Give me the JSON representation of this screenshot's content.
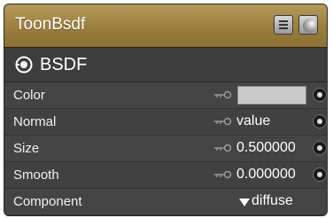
{
  "node": {
    "title": "ToonBsdf",
    "menu_icon": "menu-icon",
    "preview_icon": "sphere-preview-icon",
    "output": {
      "label": "BSDF",
      "icon": "output-socket-icon"
    }
  },
  "inputs": [
    {
      "label": "Color",
      "kind": "color",
      "swatch_color": "#c9c9c9"
    },
    {
      "label": "Normal",
      "kind": "text",
      "value": "value"
    },
    {
      "label": "Size",
      "kind": "number",
      "value": "0.500000"
    },
    {
      "label": "Smooth",
      "kind": "number",
      "value": "0.000000"
    },
    {
      "label": "Component",
      "kind": "dropdown",
      "value": "diffuse"
    }
  ],
  "colors": {
    "title_bar": "#9a7f3e",
    "node_body": "#464646",
    "text": "#ffffff"
  }
}
